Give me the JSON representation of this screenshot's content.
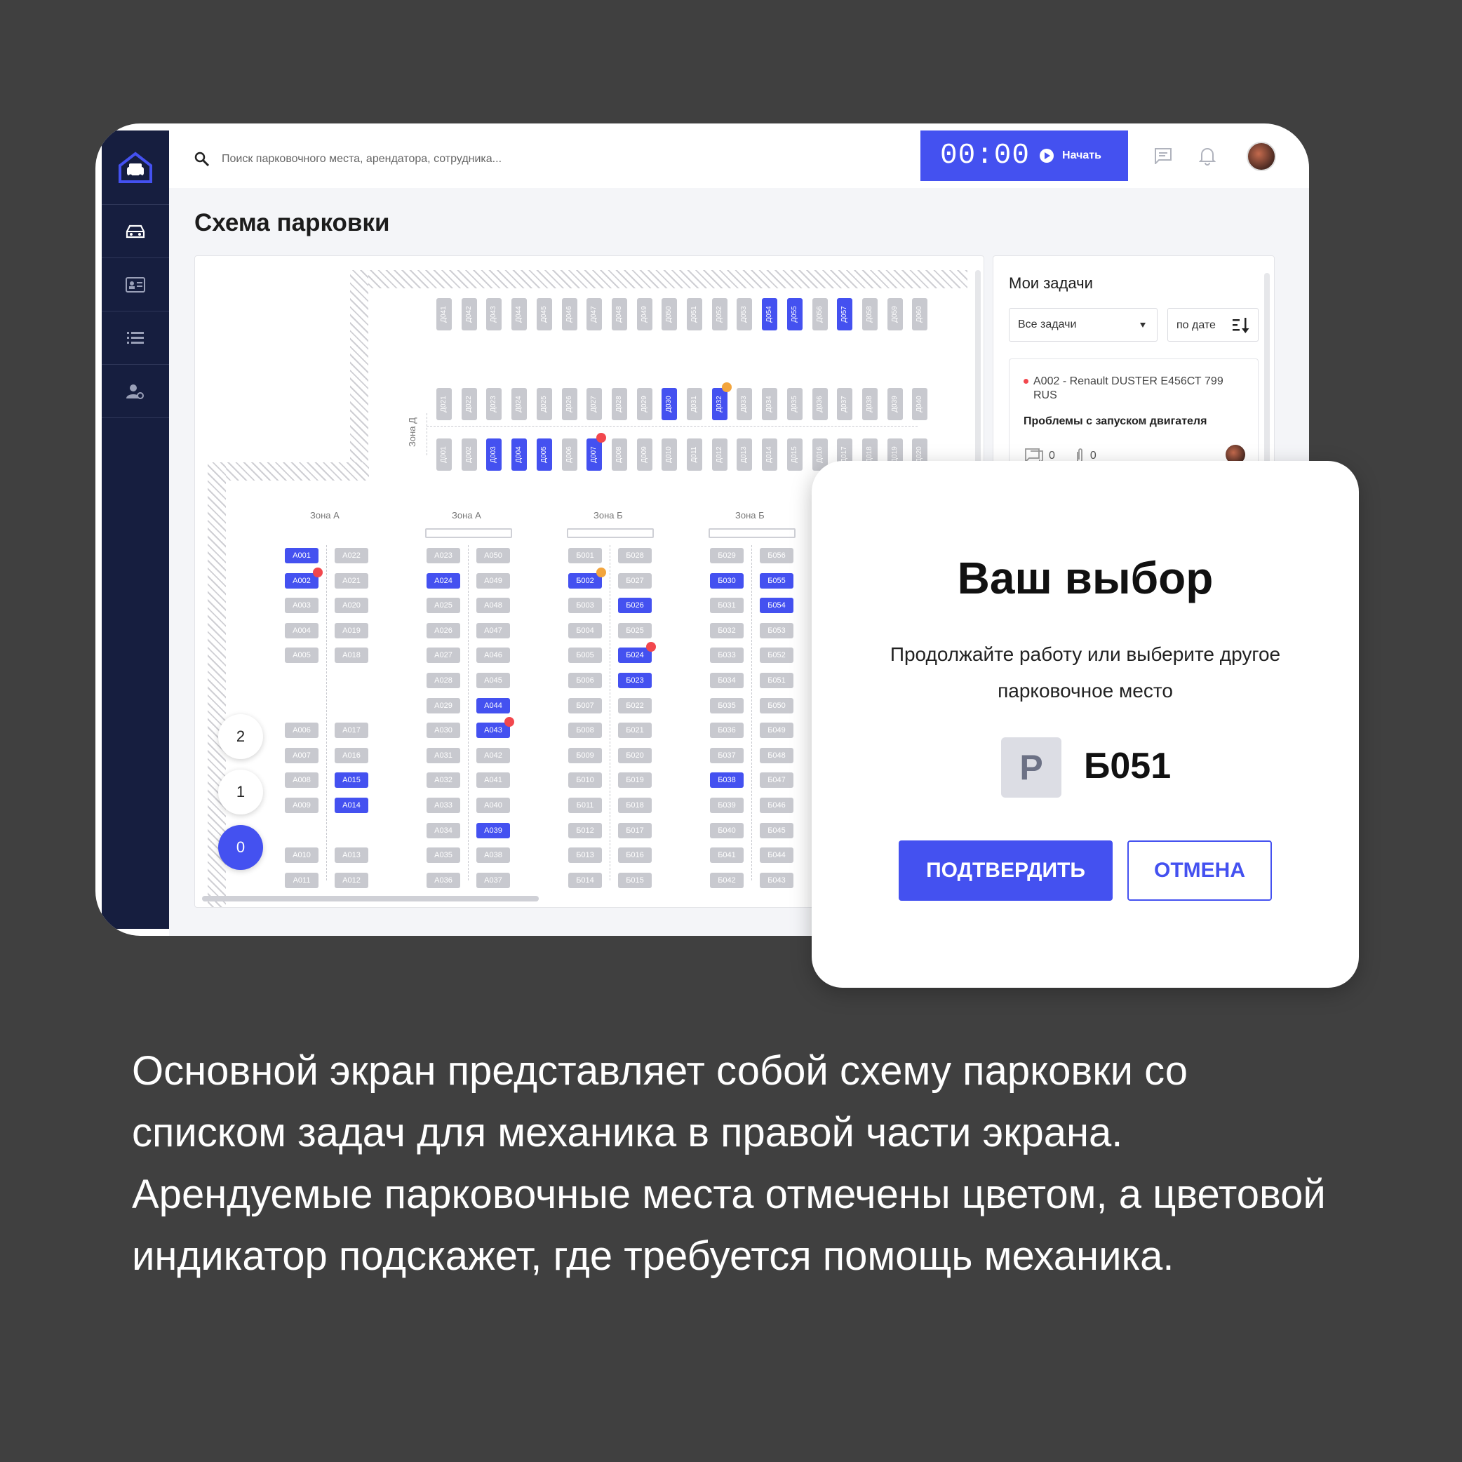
{
  "topbar": {
    "search_placeholder": "Поиск парковочного места, арендатора, сотрудника...",
    "timer": "00:00",
    "start_label": "Начать"
  },
  "sidebar": {
    "items": [
      {
        "icon": "car-icon",
        "active": true
      },
      {
        "icon": "id-card-icon",
        "active": false
      },
      {
        "icon": "list-icon",
        "active": false
      },
      {
        "icon": "user-settings-icon",
        "active": false
      }
    ]
  },
  "page": {
    "title": "Схема парковки"
  },
  "map": {
    "zone_labels": [
      "Зона А",
      "Зона А",
      "Зона Б",
      "Зона Б"
    ],
    "zone_d_label": "Зона Д",
    "floors": [
      "2",
      "1",
      "0"
    ],
    "active_floor": "0",
    "row_d_top": [
      "Д041",
      "Д042",
      "Д043",
      "Д044",
      "Д045",
      "Д046",
      "Д047",
      "Д048",
      "Д049",
      "Д050",
      "Д051",
      "Д052",
      "Д053",
      "Д054",
      "Д055",
      "Д056",
      "Д057",
      "Д058",
      "Д059",
      "Д060"
    ],
    "row_d_top_occupied": [
      "Д054",
      "Д055",
      "Д057"
    ],
    "row_d_mid": [
      "Д021",
      "Д022",
      "Д023",
      "Д024",
      "Д025",
      "Д026",
      "Д027",
      "Д028",
      "Д029",
      "Д030",
      "Д031",
      "Д032",
      "Д033",
      "Д034",
      "Д035",
      "Д036",
      "Д037",
      "Д038",
      "Д039",
      "Д040"
    ],
    "row_d_mid_occupied": [
      "Д030",
      "Д032"
    ],
    "row_d_bot": [
      "Д001",
      "Д002",
      "Д003",
      "Д004",
      "Д005",
      "Д006",
      "Д007",
      "Д008",
      "Д009",
      "Д010",
      "Д011",
      "Д012",
      "Д013",
      "Д014",
      "Д015",
      "Д016",
      "Д017",
      "Д018",
      "Д019",
      "Д020"
    ],
    "row_d_bot_occupied": [
      "Д003",
      "Д004",
      "Д005",
      "Д007"
    ],
    "columns": [
      {
        "spots": [
          "А001",
          "А002",
          "А003",
          "А004",
          "А005",
          "",
          "",
          "А006",
          "А007",
          "А008",
          "А009",
          "",
          "А010",
          "А011"
        ]
      },
      {
        "spots": [
          "А022",
          "А021",
          "А020",
          "А019",
          "А018",
          "",
          "",
          "А017",
          "А016",
          "А015",
          "А014",
          "",
          "А013",
          "А012"
        ]
      },
      {
        "spots": [
          "А023",
          "А024",
          "А025",
          "А026",
          "А027",
          "А028",
          "А029",
          "А030",
          "А031",
          "А032",
          "А033",
          "А034",
          "А035",
          "А036"
        ]
      },
      {
        "spots": [
          "А050",
          "А049",
          "А048",
          "А047",
          "А046",
          "А045",
          "А044",
          "А043",
          "А042",
          "А041",
          "А040",
          "А039",
          "А038",
          "А037"
        ]
      },
      {
        "spots": [
          "Б001",
          "Б002",
          "Б003",
          "Б004",
          "Б005",
          "Б006",
          "Б007",
          "Б008",
          "Б009",
          "Б010",
          "Б011",
          "Б012",
          "Б013",
          "Б014"
        ]
      },
      {
        "spots": [
          "Б028",
          "Б027",
          "Б026",
          "Б025",
          "Б024",
          "Б023",
          "Б022",
          "Б021",
          "Б020",
          "Б019",
          "Б018",
          "Б017",
          "Б016",
          "Б015"
        ]
      },
      {
        "spots": [
          "Б029",
          "Б030",
          "Б031",
          "Б032",
          "Б033",
          "Б034",
          "Б035",
          "Б036",
          "Б037",
          "Б038",
          "Б039",
          "Б040",
          "Б041",
          "Б042"
        ]
      },
      {
        "spots": [
          "Б056",
          "Б055",
          "Б054",
          "Б053",
          "Б052",
          "Б051",
          "Б050",
          "Б049",
          "Б048",
          "Б047",
          "Б046",
          "Б045",
          "Б044",
          "Б043"
        ]
      }
    ],
    "occupied": [
      "А001",
      "А002",
      "А015",
      "А014",
      "А024",
      "А044",
      "А043",
      "А039",
      "Б002",
      "Б026",
      "Б024",
      "Б023",
      "Б030",
      "Б038",
      "Б055",
      "Б054"
    ],
    "alerts_red": [
      "А002",
      "А043",
      "Б024",
      "Д007"
    ],
    "alerts_orange": [
      "Б002",
      "Д032"
    ]
  },
  "tasks": {
    "title": "Мои задачи",
    "filter": "Все задачи",
    "sort": "по дате",
    "items": [
      {
        "car": "А002 - Renault DUSTER Е456СТ 799 RUS",
        "problem": "Проблемы с запуском двигателя",
        "comments": "0",
        "attachments": "0"
      }
    ]
  },
  "modal": {
    "title": "Ваш выбор",
    "text": "Продолжайте работу или выберите другое парковочное место",
    "p_badge": "P",
    "spot": "Б051",
    "confirm": "ПОДТВЕРДИТЬ",
    "cancel": "ОТМЕНА"
  },
  "caption": "Основной экран представляет собой схему парковки со списком задач для механика в правой части экрана. Арендуемые парковочные места отмечены цветом, а цветовой индикатор подскажет, где требуется помощь механика.",
  "colors": {
    "accent": "#4451f0",
    "sidebar": "#161e3f",
    "alert_red": "#f2474d",
    "alert_orange": "#f3a53d",
    "background": "#404040"
  }
}
